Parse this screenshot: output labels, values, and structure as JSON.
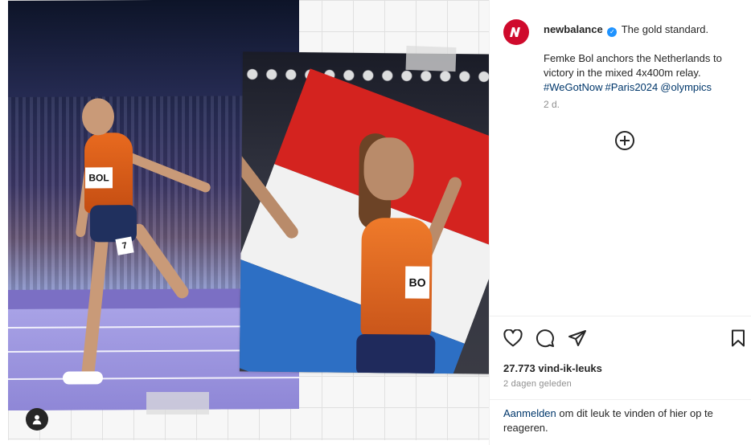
{
  "post": {
    "username": "newbalance",
    "verified": true,
    "caption_first": "The gold standard.",
    "caption_body": "Femke Bol anchors the Netherlands to victory in the mixed 4x400m relay.",
    "hashtags": [
      "#WeGotNow",
      "#Paris2024",
      "@olympics"
    ],
    "age": "2 d.",
    "likes": "27.773 vind-ik-leuks",
    "date": "2 dagen geleden"
  },
  "images": {
    "left_bib": "BOL",
    "left_hip_number": "7",
    "right_bib": "BO"
  },
  "icons": {
    "brand_avatar": "new-balance-logo",
    "add": "plus-circle-icon",
    "like": "heart-icon",
    "comment": "comment-icon",
    "share": "send-icon",
    "save": "bookmark-icon",
    "user": "user-icon"
  },
  "login_prompt": {
    "link": "Aanmelden",
    "text": " om dit leuk te vinden of hier op te reageren."
  },
  "colors": {
    "brand": "#cf0a2c",
    "link": "#00376b",
    "verified": "#1f93ff",
    "muted": "#8e8e8e"
  }
}
